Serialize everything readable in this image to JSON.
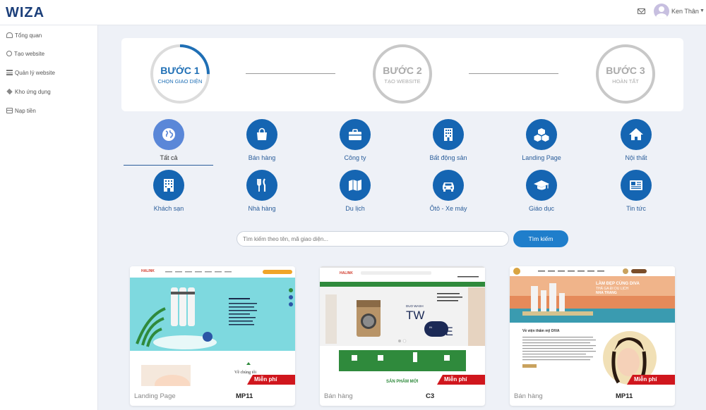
{
  "header": {
    "logo_text": "WIZA",
    "user_name": "Ken Thân",
    "mail_icon": "mail-icon",
    "caret_icon": "chevron-down-icon"
  },
  "sidebar": {
    "items": [
      {
        "label": "Tổng quan",
        "icon": "dashboard-icon"
      },
      {
        "label": "Tạo website",
        "icon": "globe-icon"
      },
      {
        "label": "Quản lý website",
        "icon": "list-icon"
      },
      {
        "label": "Kho ứng dụng",
        "icon": "cubes-icon"
      },
      {
        "label": "Nạp tiền",
        "icon": "credit-card-icon"
      }
    ]
  },
  "steps": [
    {
      "title": "BƯỚC 1",
      "subtitle": "CHỌN GIAO DIỆN",
      "state": "active",
      "progress": 0.25
    },
    {
      "title": "BƯỚC 2",
      "subtitle": "TẠO WEBSITE",
      "state": "inactive",
      "progress": 0
    },
    {
      "title": "BƯỚC 3",
      "subtitle": "HOÀN TẤT",
      "state": "inactive",
      "progress": 0
    }
  ],
  "categories": [
    {
      "label": "Tất cả",
      "icon": "globe-icon",
      "selected": true
    },
    {
      "label": "Bán hàng",
      "icon": "shopping-bag-icon"
    },
    {
      "label": "Công ty",
      "icon": "briefcase-icon"
    },
    {
      "label": "Bất động sản",
      "icon": "building-icon"
    },
    {
      "label": "Landing Page",
      "icon": "cubes-icon"
    },
    {
      "label": "Nội thất",
      "icon": "home-icon"
    },
    {
      "label": "Khách sạn",
      "icon": "hotel-icon"
    },
    {
      "label": "Nhà hàng",
      "icon": "utensils-icon"
    },
    {
      "label": "Du lịch",
      "icon": "map-icon"
    },
    {
      "label": "Ôtô - Xe máy",
      "icon": "car-icon"
    },
    {
      "label": "Giáo dục",
      "icon": "graduation-cap-icon"
    },
    {
      "label": "Tin tức",
      "icon": "newspaper-icon"
    }
  ],
  "search": {
    "placeholder": "Tìm kiếm theo tên, mã giao diện...",
    "value": "",
    "button_label": "Tìm kiếm"
  },
  "templates": [
    {
      "category": "Landing Page",
      "code": "MP11",
      "badge": "Miễn phí",
      "brand": "HALINK",
      "body_heading": "Về chúng tôi"
    },
    {
      "category": "Bán hàng",
      "code": "C3",
      "badge": "Miễn phí",
      "brand": "HALINK",
      "banner_brand": "DUO WASH",
      "banner_word_1": "TW",
      "banner_word_2": "ONE",
      "banner_word_mid": "IN",
      "section_title": "SẢN PHẨM MỚI"
    },
    {
      "category": "Bán hàng",
      "code": "MP11",
      "badge": "Miễn phí",
      "banner_title": "LÀM ĐẸP CÙNG DIVA",
      "banner_sub": "THẢ GA ĐI DU LỊCH",
      "banner_place": "NHA TRANG",
      "body_heading": "Về viện thẩm mỹ DIVA"
    }
  ],
  "colors": {
    "primary": "#1565b2",
    "selected_category": "#5a87d8",
    "search_button": "#1f7ecb",
    "badge": "#d0161d",
    "step_inactive": "#c8c8c8"
  }
}
